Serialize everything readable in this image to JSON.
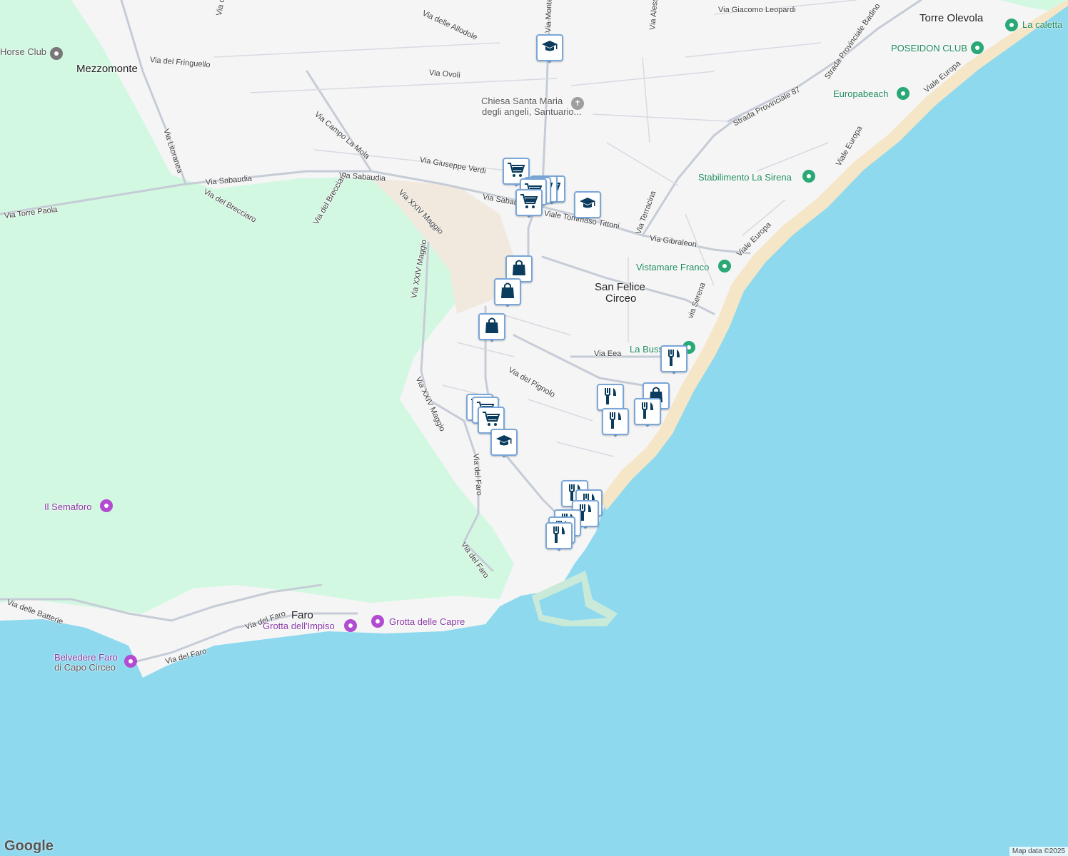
{
  "map": {
    "colors": {
      "water": "#8fd9ef",
      "land": "#f5f5f6",
      "park": "#d3f8e2",
      "beach": "#f4e6c6",
      "road": "#c6ccd6"
    },
    "places": [
      {
        "id": "mezzomonte",
        "text": "Mezzomonte"
      },
      {
        "id": "torre-olevola",
        "text": "Torre Olevola"
      },
      {
        "id": "san-felice-1",
        "text": "San Felice"
      },
      {
        "id": "san-felice-2",
        "text": "Circeo"
      },
      {
        "id": "faro",
        "text": "Faro"
      }
    ],
    "streets": [
      "Via delle Allodole",
      "Via dei Cardellini",
      "Via del Fringuello",
      "Via Ovoli",
      "Via Giacomo Leopardi",
      "Via Alessandro Manzoni",
      "Via Monte Circeo",
      "Via Litoranea",
      "Via Campo La Mola",
      "Via Giuseppe Verdi",
      "Via Sabaudia",
      "Via Sabaudia",
      "Via Torre Paola",
      "Via del Brecciaro",
      "Via del Brecciaro",
      "Via XXIV Maggio",
      "Via XXIV Maggio",
      "Via XXIV Maggio",
      "Via Sabaudia",
      "Viale Tommaso Tittoni",
      "Via Gibraleon",
      "Via Terracina",
      "Strada Provinciale Badino",
      "Strada Provinciale 87",
      "Viale Europa",
      "Viale Europa",
      "Viale Europa",
      "via Serena",
      "Via Eea",
      "Via del Pignolo",
      "Via del Faro",
      "Via del Faro",
      "Via delle Batterie",
      "Via del Faro",
      "Via del Faro"
    ],
    "pois": [
      {
        "id": "horse-club",
        "text": "Horse Club",
        "kind": "gray"
      },
      {
        "id": "chiesa-1",
        "text": "Chiesa Santa Maria",
        "kind": "cross"
      },
      {
        "id": "chiesa-2",
        "text": "degli angeli, Santuario...",
        "kind": "none"
      },
      {
        "id": "la-caletta",
        "text": "La caletta",
        "kind": "green"
      },
      {
        "id": "poseidon",
        "text": "POSEIDON CLUB",
        "kind": "green"
      },
      {
        "id": "europabeach",
        "text": "Europabeach",
        "kind": "green"
      },
      {
        "id": "la-sirena",
        "text": "Stabilimento La Sirena",
        "kind": "green"
      },
      {
        "id": "vistamare",
        "text": "Vistamare Franco",
        "kind": "green"
      },
      {
        "id": "la-bussola",
        "text": "La Bussola",
        "kind": "green"
      },
      {
        "id": "semaforo",
        "text": "Il Semaforo",
        "kind": "purple"
      },
      {
        "id": "grotta-impiso",
        "text": "Grotta dell'Impiso",
        "kind": "purple"
      },
      {
        "id": "grotta-capre",
        "text": "Grotta delle Capre",
        "kind": "purple"
      },
      {
        "id": "belvedere-1",
        "text": "Belvedere Faro",
        "kind": "purple"
      },
      {
        "id": "belvedere-2",
        "text": "di Capo Circeo",
        "kind": "none"
      }
    ],
    "markers": [
      {
        "type": "school"
      },
      {
        "type": "shopping-cart"
      },
      {
        "type": "shopping-cart"
      },
      {
        "type": "shopping-cart"
      },
      {
        "type": "shopping-cart"
      },
      {
        "type": "shopping-cart"
      },
      {
        "type": "shopping-cart"
      },
      {
        "type": "school"
      },
      {
        "type": "shopping-bag"
      },
      {
        "type": "shopping-bag"
      },
      {
        "type": "shopping-bag"
      },
      {
        "type": "shopping-cart"
      },
      {
        "type": "shopping-cart"
      },
      {
        "type": "shopping-cart"
      },
      {
        "type": "school"
      },
      {
        "type": "restaurant"
      },
      {
        "type": "restaurant"
      },
      {
        "type": "shopping-bag"
      },
      {
        "type": "restaurant"
      },
      {
        "type": "restaurant"
      },
      {
        "type": "restaurant"
      },
      {
        "type": "restaurant"
      },
      {
        "type": "restaurant"
      },
      {
        "type": "restaurant"
      },
      {
        "type": "restaurant"
      },
      {
        "type": "restaurant"
      }
    ],
    "attribution": "Map data ©2025",
    "logo": "Google"
  }
}
